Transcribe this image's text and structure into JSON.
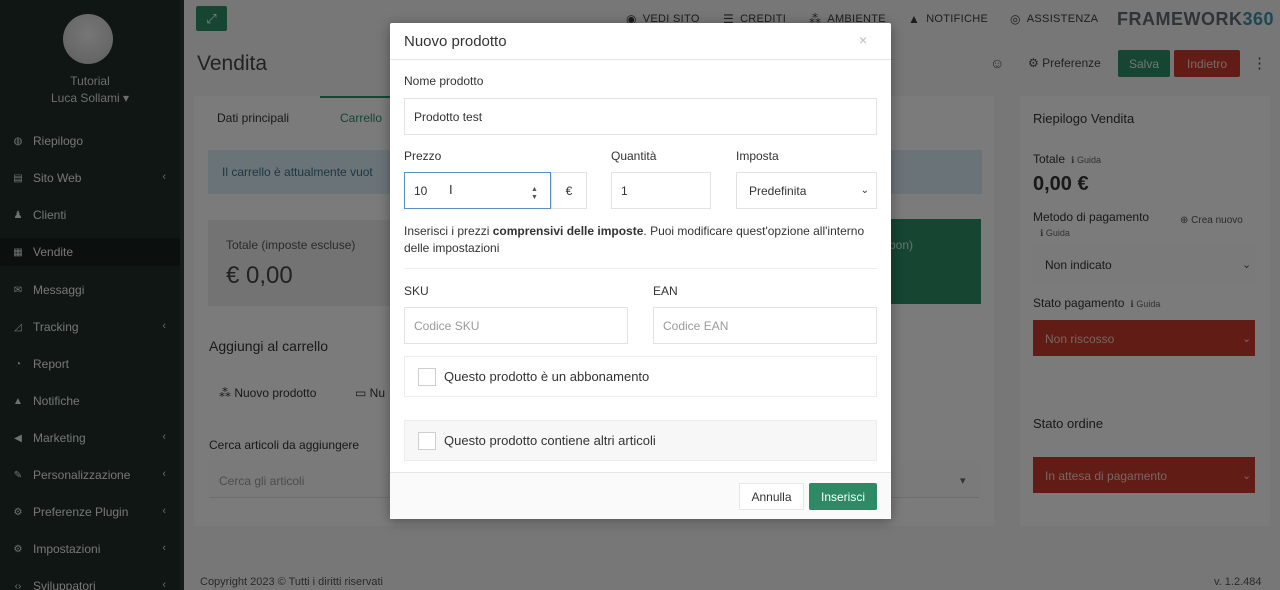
{
  "sidebar": {
    "user_org": "Tutorial",
    "user_name": "Luca Sollami ▾",
    "items": [
      {
        "label": "Riepilogo",
        "icon": "dashboard-icon",
        "glyph": "◍"
      },
      {
        "label": "Sito Web",
        "icon": "file-icon",
        "glyph": "▤"
      },
      {
        "label": "Clienti",
        "icon": "user-icon",
        "glyph": "♟"
      },
      {
        "label": "Vendite",
        "icon": "calculator-icon",
        "glyph": "▦"
      },
      {
        "label": "Messaggi",
        "icon": "envelope-icon",
        "glyph": "✉"
      },
      {
        "label": "Tracking",
        "icon": "chart-icon",
        "glyph": "◿"
      },
      {
        "label": "Report",
        "icon": "pie-chart-icon",
        "glyph": "◔"
      },
      {
        "label": "Notifiche",
        "icon": "bell-icon",
        "glyph": "▲"
      },
      {
        "label": "Marketing",
        "icon": "bullhorn-icon",
        "glyph": "◀"
      },
      {
        "label": "Personalizzazione",
        "icon": "brush-icon",
        "glyph": "✎"
      },
      {
        "label": "Preferenze Plugin",
        "icon": "plug-icon",
        "glyph": "⚙"
      },
      {
        "label": "Impostazioni",
        "icon": "gear-icon",
        "glyph": "⚙"
      },
      {
        "label": "Sviluppatori",
        "icon": "code-icon",
        "glyph": "‹›"
      }
    ]
  },
  "topbar": {
    "links": [
      {
        "label": "VEDI SITO",
        "glyph": "◉"
      },
      {
        "label": "CREDITI",
        "glyph": "☰"
      },
      {
        "label": "AMBIENTE",
        "glyph": "⁂"
      },
      {
        "label": "NOTIFICHE",
        "glyph": "▲"
      },
      {
        "label": "ASSISTENZA",
        "glyph": "◎"
      }
    ],
    "brand_text": "FRAMEWORK",
    "brand_num": "360"
  },
  "page": {
    "title": "Vendita",
    "pref_label": "⚙ Preferenze",
    "save_label": "Salva",
    "back_label": "Indietro",
    "tabs": [
      "Dati principali",
      "Carrello"
    ],
    "info_text": "Il carrello è attualmente vuot",
    "totals_label": "Totale (imposte escluse)",
    "totals_value": "€ 0,00",
    "coupon_text": "pon)",
    "add_title": "Aggiungi al carrello",
    "add_new_product": "⁂ Nuovo prodotto",
    "add_other": "▭ Nu",
    "search_label": "Cerca articoli da aggiungere",
    "search_placeholder": "Cerca gli articoli",
    "footer_copy": "Copyright 2023 © Tutti i diritti riservati",
    "footer_version": "v. 1.2.484"
  },
  "summary": {
    "title": "Riepilogo Vendita",
    "total_label": "Totale",
    "guide_label": "ℹ Guida",
    "total_value": "0,00 €",
    "method_label": "Metodo di pagamento",
    "create_new": "⊕ Crea nuovo",
    "method_value": "Non indicato",
    "pay_status_label": "Stato pagamento",
    "pay_status_value": "Non riscosso",
    "order_status_label": "Stato ordine",
    "order_status_value": "In attesa di pagamento"
  },
  "modal": {
    "title": "Nuovo prodotto",
    "close": "×",
    "name_label": "Nome prodotto",
    "name_value": "Prodotto test",
    "price_label": "Prezzo",
    "price_value": "10",
    "currency": "€",
    "qty_label": "Quantità",
    "qty_value": "1",
    "tax_label": "Imposta",
    "tax_value": "Predefinita",
    "help_pre": "Inserisci i prezzi ",
    "help_bold": "comprensivi delle imposte",
    "help_post": ". Puoi modificare quest'opzione all'interno delle impostazioni",
    "sku_label": "SKU",
    "sku_placeholder": "Codice SKU",
    "ean_label": "EAN",
    "ean_placeholder": "Codice EAN",
    "subscription_label": "Questo prodotto è un abbonamento",
    "bundle_label": "Questo prodotto contiene altri articoli",
    "cancel_label": "Annulla",
    "insert_label": "Inserisci"
  },
  "colors": {
    "sidebar": "#1f2d27",
    "accent": "#2d8a64",
    "danger": "#c0392b"
  }
}
